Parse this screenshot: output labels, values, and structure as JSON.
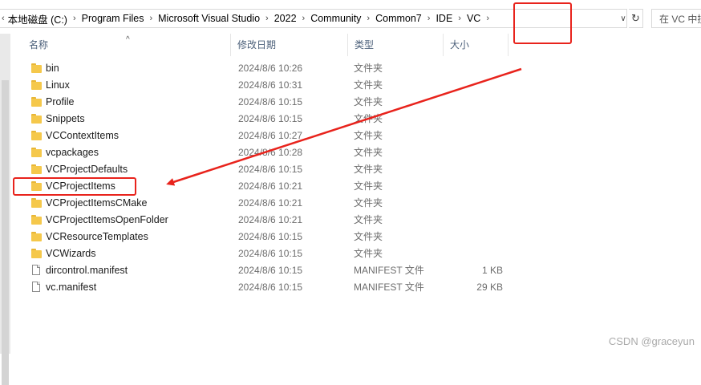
{
  "address_bar": {
    "crumbs": [
      "本地磁盘 (C:)",
      "Program Files",
      "Microsoft Visual Studio",
      "2022",
      "Community",
      "Common7",
      "IDE",
      "VC"
    ],
    "search_placeholder": "在 VC 中搜索"
  },
  "columns": {
    "name": "名称",
    "date": "修改日期",
    "type": "类型",
    "size": "大小"
  },
  "files": [
    {
      "name": "bin",
      "date": "2024/8/6 10:26",
      "type": "文件夹",
      "size": "",
      "icon": "folder-icon"
    },
    {
      "name": "Linux",
      "date": "2024/8/6 10:31",
      "type": "文件夹",
      "size": "",
      "icon": "folder-icon"
    },
    {
      "name": "Profile",
      "date": "2024/8/6 10:15",
      "type": "文件夹",
      "size": "",
      "icon": "folder-icon"
    },
    {
      "name": "Snippets",
      "date": "2024/8/6 10:15",
      "type": "文件夹",
      "size": "",
      "icon": "folder-icon"
    },
    {
      "name": "VCContextItems",
      "date": "2024/8/6 10:27",
      "type": "文件夹",
      "size": "",
      "icon": "folder-icon"
    },
    {
      "name": "vcpackages",
      "date": "2024/8/6 10:28",
      "type": "文件夹",
      "size": "",
      "icon": "folder-icon"
    },
    {
      "name": "VCProjectDefaults",
      "date": "2024/8/6 10:15",
      "type": "文件夹",
      "size": "",
      "icon": "folder-icon"
    },
    {
      "name": "VCProjectItems",
      "date": "2024/8/6 10:21",
      "type": "文件夹",
      "size": "",
      "icon": "folder-icon"
    },
    {
      "name": "VCProjectItemsCMake",
      "date": "2024/8/6 10:21",
      "type": "文件夹",
      "size": "",
      "icon": "folder-icon"
    },
    {
      "name": "VCProjectItemsOpenFolder",
      "date": "2024/8/6 10:21",
      "type": "文件夹",
      "size": "",
      "icon": "folder-icon"
    },
    {
      "name": "VCResourceTemplates",
      "date": "2024/8/6 10:15",
      "type": "文件夹",
      "size": "",
      "icon": "folder-icon"
    },
    {
      "name": "VCWizards",
      "date": "2024/8/6 10:15",
      "type": "文件夹",
      "size": "",
      "icon": "folder-icon"
    },
    {
      "name": "dircontrol.manifest",
      "date": "2024/8/6 10:15",
      "type": "MANIFEST 文件",
      "size": "1 KB",
      "icon": "file-icon"
    },
    {
      "name": "vc.manifest",
      "date": "2024/8/6 10:15",
      "type": "MANIFEST 文件",
      "size": "29 KB",
      "icon": "file-icon"
    }
  ],
  "watermark": "CSDN @graceyun",
  "colors": {
    "annotation": "#e8231c",
    "folder": "#f5c84b",
    "header_text": "#4c607a"
  }
}
